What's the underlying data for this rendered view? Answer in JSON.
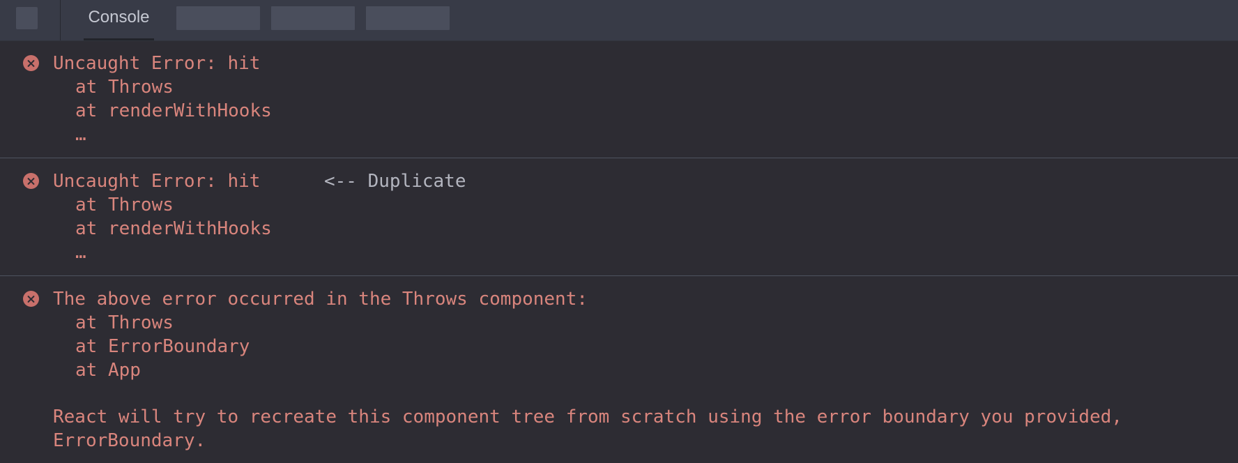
{
  "toolbar": {
    "tab_console": "Console"
  },
  "entries": [
    {
      "message": "Uncaught Error: hit",
      "stack": [
        "at Throws",
        "at renderWithHooks",
        "…"
      ]
    },
    {
      "message": "Uncaught Error: hit",
      "annotation": "<-- Duplicate",
      "stack": [
        "at Throws",
        "at renderWithHooks",
        "…"
      ]
    },
    {
      "message": "The above error occurred in the Throws component:",
      "stack": [
        "at Throws",
        "at ErrorBoundary",
        "at App"
      ],
      "note_line1": "React will try to recreate this component tree from scratch using the error boundary you provided,",
      "note_line2": "ErrorBoundary."
    }
  ],
  "colors": {
    "error_text": "#d9857d",
    "annotation_text": "#b3b5bf",
    "background": "#2d2c33",
    "toolbar": "#383b47"
  },
  "icons": {
    "error": "error-circle-x-icon"
  }
}
